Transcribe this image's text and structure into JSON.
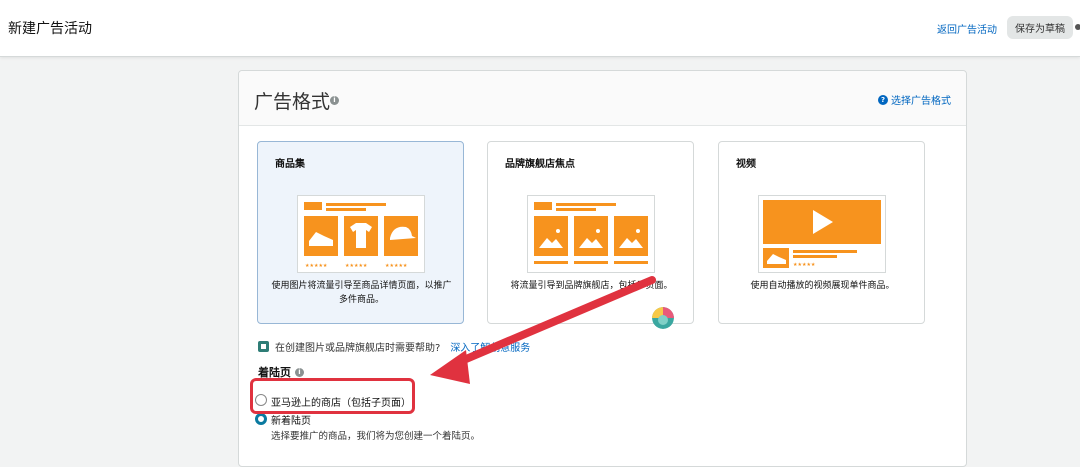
{
  "header": {
    "title": "新建广告活动",
    "back_link": "返回广告活动",
    "save_draft": "保存为草稿"
  },
  "ad_format": {
    "title": "广告格式",
    "choose_link": "选择广告格式",
    "tiles": [
      {
        "name": "商品集",
        "desc": "使用图片将流量引导至商品详情页面，以推广多件商品。",
        "selected": true
      },
      {
        "name": "品牌旗舰店焦点",
        "desc": "将流量引导到品牌旗舰店，包括子页面。",
        "selected": false
      },
      {
        "name": "视频",
        "desc": "使用自动播放的视频展现单件商品。",
        "selected": false
      }
    ],
    "help_text": "在创建图片或品牌旗舰店时需要帮助?",
    "help_link": "深入了解创意服务"
  },
  "landing_page": {
    "label": "着陆页",
    "options": [
      {
        "label": "亚马逊上的商店（包括子页面）",
        "checked": false
      },
      {
        "label": "新着陆页",
        "sub": "选择要推广的商品，我们将为您创建一个着陆页。",
        "checked": true
      }
    ]
  },
  "colors": {
    "accent": "#0066c0",
    "art_orange": "#f7931e",
    "annotation_red": "#e0323f",
    "radio_checked": "#0a7aa0"
  }
}
